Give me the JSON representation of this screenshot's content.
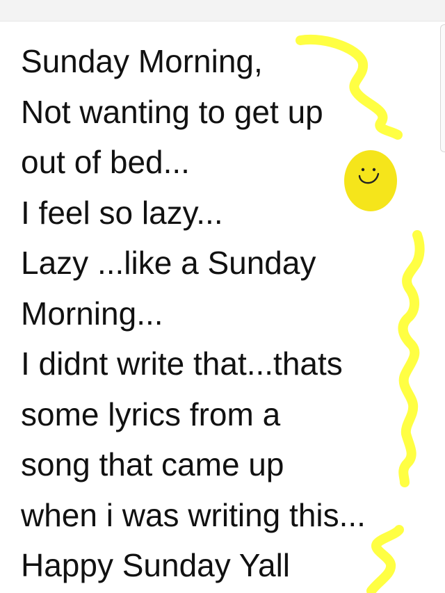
{
  "note": {
    "lines": [
      "Sunday Morning,",
      "Not wanting to get up",
      "out of bed...",
      "I feel so lazy...",
      "Lazy ...like a Sunday",
      "Morning...",
      "I didnt write that...thats",
      "some lyrics from a",
      "song that came up",
      "when i was writing this...",
      "Happy Sunday Yall"
    ]
  },
  "doodles": {
    "highlighter_color": "#ffff33",
    "sun_color": "#f5e51b",
    "face_ink_color": "#222222",
    "shapes": [
      "squiggle-line",
      "smiley-sun",
      "squiggle-line",
      "squiggle-line"
    ]
  }
}
